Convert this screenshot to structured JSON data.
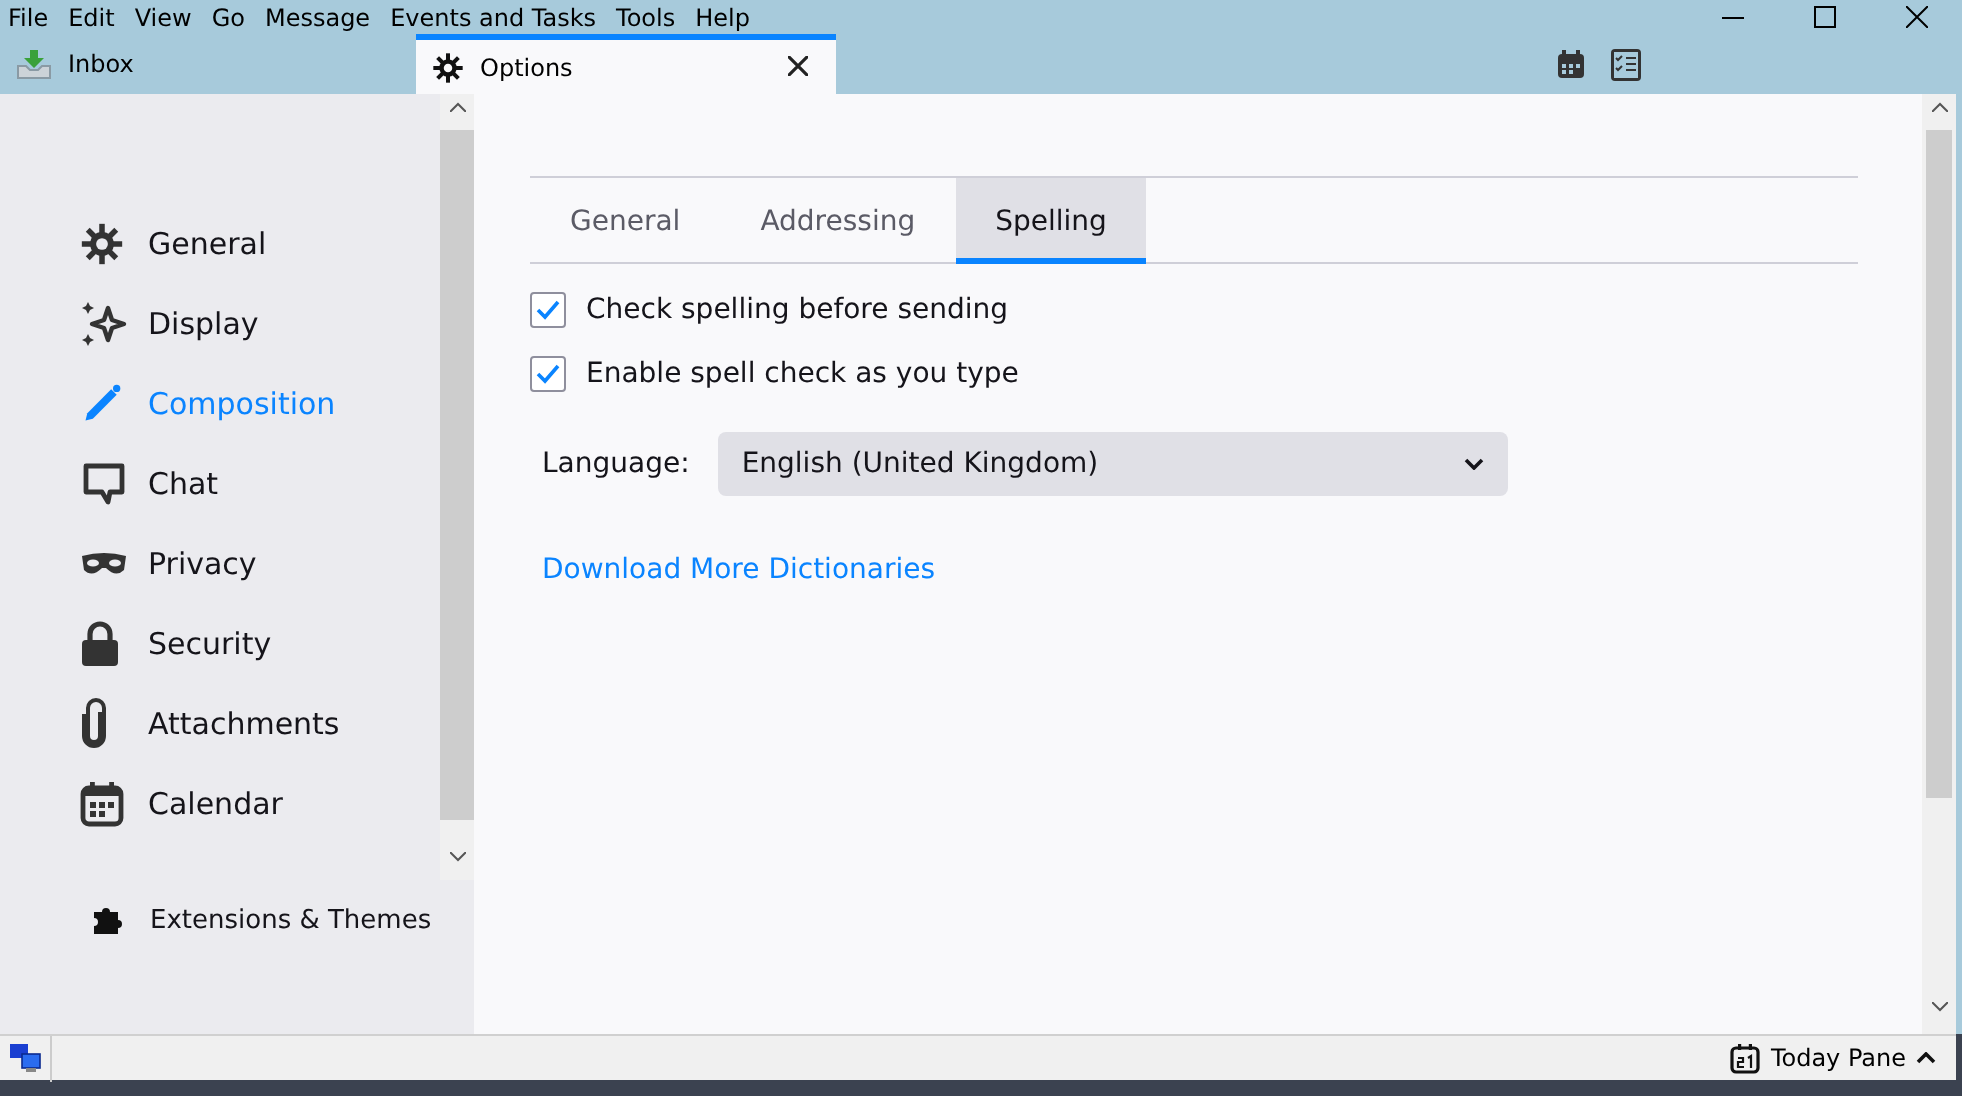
{
  "menu": [
    "File",
    "Edit",
    "View",
    "Go",
    "Message",
    "Events and Tasks",
    "Tools",
    "Help"
  ],
  "tabs": [
    {
      "label": "Inbox",
      "kind": "inbox",
      "selected": false
    },
    {
      "label": "Options",
      "kind": "options",
      "selected": true
    }
  ],
  "sidebar": {
    "items": [
      {
        "label": "General",
        "kind": "gear",
        "selected": false
      },
      {
        "label": "Display",
        "kind": "sparkle",
        "selected": false
      },
      {
        "label": "Composition",
        "kind": "pencil",
        "selected": true
      },
      {
        "label": "Chat",
        "kind": "chat",
        "selected": false
      },
      {
        "label": "Privacy",
        "kind": "mask",
        "selected": false
      },
      {
        "label": "Security",
        "kind": "lock",
        "selected": false
      },
      {
        "label": "Attachments",
        "kind": "clip",
        "selected": false
      },
      {
        "label": "Calendar",
        "kind": "calendar",
        "selected": false
      }
    ],
    "footer": "Extensions & Themes"
  },
  "subtabs": [
    {
      "label": "General",
      "selected": false
    },
    {
      "label": "Addressing",
      "selected": false
    },
    {
      "label": "Spelling",
      "selected": true
    }
  ],
  "options": [
    {
      "label": "Check spelling before sending",
      "checked": true
    },
    {
      "label": "Enable spell check as you type",
      "checked": true
    }
  ],
  "language": {
    "label": "Language:",
    "value": "English (United Kingdom)"
  },
  "link": "Download More Dictionaries",
  "status_bar": {
    "today_pane": "Today Pane"
  }
}
